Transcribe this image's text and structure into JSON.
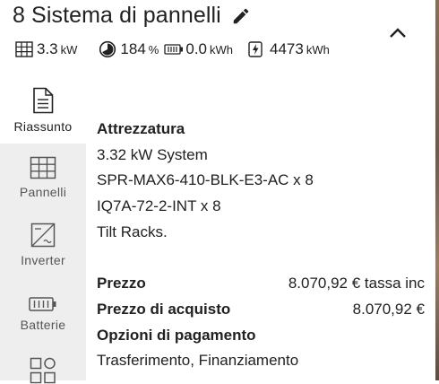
{
  "header": {
    "title": "8 Sistema di pannelli"
  },
  "stats": {
    "power_value": "3.3",
    "power_unit": "kW",
    "offset_value": "184",
    "offset_unit": "%",
    "battery_value": "0.0",
    "battery_unit": "kWh",
    "production_value": "4473",
    "production_unit": "kWh"
  },
  "nav": {
    "items": [
      {
        "label": "Riassunto",
        "icon": "document-icon"
      },
      {
        "label": "Pannelli",
        "icon": "grid-icon"
      },
      {
        "label": "Inverter",
        "icon": "inverter-icon"
      },
      {
        "label": "Batterie",
        "icon": "battery-icon"
      },
      {
        "label": "",
        "icon": "apps-icon"
      }
    ]
  },
  "summary": {
    "equipment_heading": "Attrezzatura",
    "equipment": [
      "3.32 kW System",
      "SPR-MAX6-410-BLK-E3-AC x 8",
      "IQ7A-72-2-INT x 8",
      "Tilt Racks."
    ],
    "price_label": "Prezzo",
    "price_value": "8.070,92 € tassa inc",
    "purchase_label": "Prezzo di acquisto",
    "purchase_value": "8.070,92 €",
    "payment_heading": "Opzioni di pagamento",
    "payment_options": "Trasferimento, Finanziamento"
  }
}
